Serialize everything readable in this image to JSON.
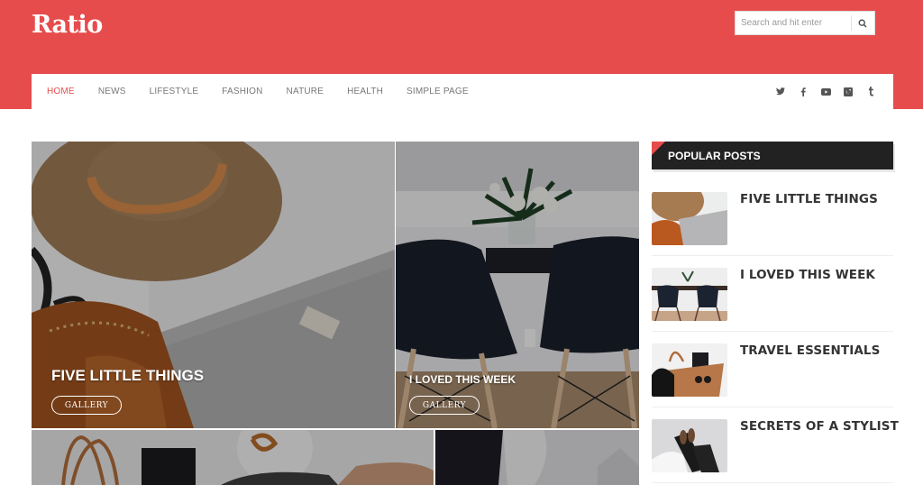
{
  "header": {
    "logo": "Ratio",
    "brand_color": "#e74c4c",
    "search": {
      "placeholder": "Search and hit enter",
      "value": "",
      "icon": "search-icon"
    }
  },
  "nav": {
    "items": [
      {
        "label": "HOME",
        "active": true
      },
      {
        "label": "NEWS",
        "active": false
      },
      {
        "label": "LIFESTYLE",
        "active": false
      },
      {
        "label": "FASHION",
        "active": false
      },
      {
        "label": "NATURE",
        "active": false
      },
      {
        "label": "HEALTH",
        "active": false
      },
      {
        "label": "SIMPLE PAGE",
        "active": false
      }
    ],
    "social": [
      "twitter-icon",
      "facebook-icon",
      "youtube-icon",
      "vimeo-icon",
      "tumblr-icon"
    ]
  },
  "featured": [
    {
      "title": "FIVE LITTLE THINGS",
      "button": "GALLERY"
    },
    {
      "title": "I LOVED THIS WEEK",
      "button": "GALLERY"
    }
  ],
  "sidebar": {
    "widget_title": "POPULAR POSTS",
    "posts": [
      {
        "title": "FIVE LITTLE THINGS"
      },
      {
        "title": "I LOVED THIS WEEK"
      },
      {
        "title": "TRAVEL ESSENTIALS"
      },
      {
        "title": "SECRETS OF A STYLIST"
      }
    ]
  }
}
